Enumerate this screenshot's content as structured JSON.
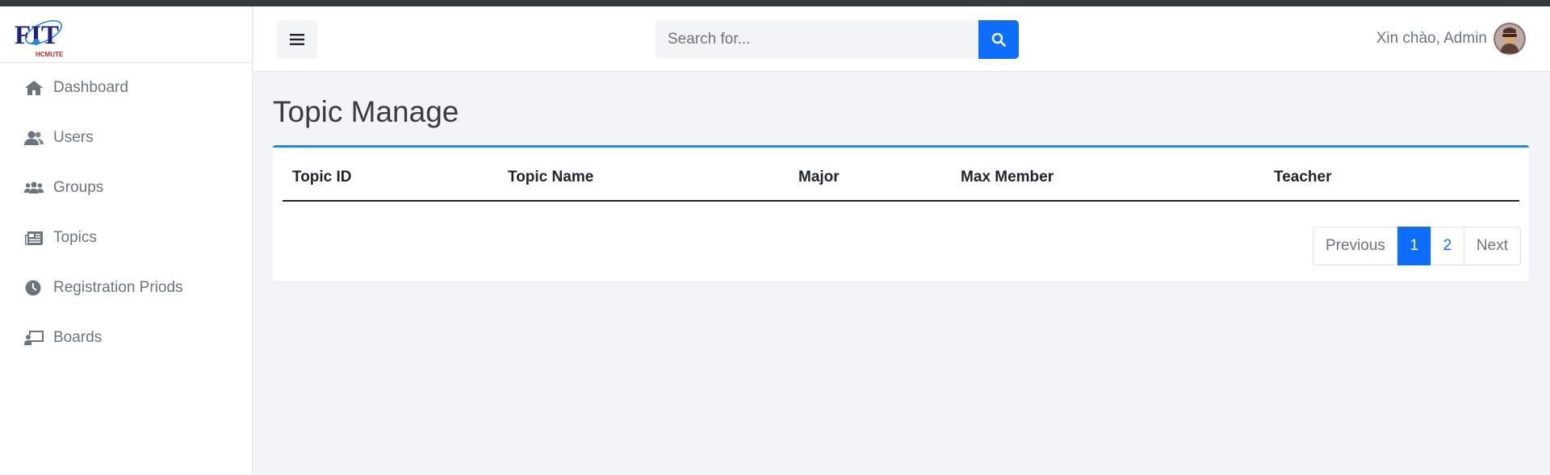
{
  "app": {
    "logo_text": "FIT",
    "logo_subtext": "HCMUTE"
  },
  "sidebar": {
    "items": [
      {
        "label": "Dashboard",
        "icon": "home-icon"
      },
      {
        "label": "Users",
        "icon": "users-icon"
      },
      {
        "label": "Groups",
        "icon": "groups-icon"
      },
      {
        "label": "Topics",
        "icon": "newspaper-icon"
      },
      {
        "label": "Registration Priods",
        "icon": "clock-icon"
      },
      {
        "label": "Boards",
        "icon": "chalkboard-teacher-icon"
      }
    ]
  },
  "header": {
    "search_placeholder": "Search for...",
    "greeting": "Xin chào, Admin"
  },
  "main": {
    "title": "Topic Manage",
    "table": {
      "columns": [
        "Topic ID",
        "Topic Name",
        "Major",
        "Max Member",
        "Teacher"
      ],
      "rows": []
    },
    "pagination": {
      "previous": "Previous",
      "pages": [
        "1",
        "2"
      ],
      "active_page": "1",
      "next": "Next"
    }
  },
  "colors": {
    "accent": "#0d6efd",
    "card_border": "#1e88e5",
    "sidebar_text": "#6c757d",
    "topbar": "#343a40"
  }
}
